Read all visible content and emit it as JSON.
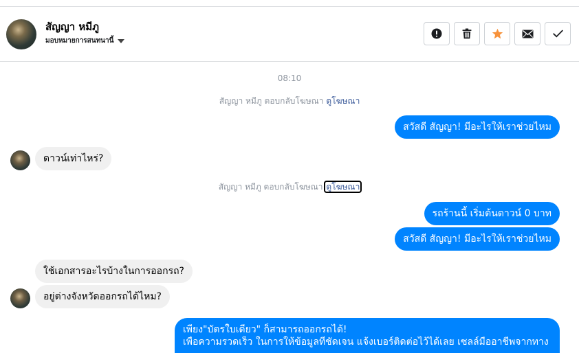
{
  "contact": {
    "name": "สัญญา หมีภู",
    "assign_label": "มอบหมายการสนทนานี้"
  },
  "actions": [
    {
      "name": "report-button",
      "icon": "exclamation-circle-icon"
    },
    {
      "name": "delete-button",
      "icon": "trash-icon"
    },
    {
      "name": "star-button",
      "icon": "star-icon"
    },
    {
      "name": "mark-unread-button",
      "icon": "envelope-icon"
    },
    {
      "name": "mark-done-button",
      "icon": "checkmark-icon"
    }
  ],
  "thread": {
    "time": "08:10",
    "notice_text": "สัญญา หมีภู ตอบกลับโฆษณา",
    "notice_link": "ดูโฆษณา",
    "messages": [
      "สวัสดี สัญญา! มีอะไรให้เราช่วยไหม",
      "ดาวน์เท่าไหร่?",
      "รถร้านนี้ เริ่มต้นดาวน์ 0 บาท",
      "สวัสดี สัญญา! มีอะไรให้เราช่วยไหม",
      "ใช้เอกสารอะไรบ้างในการออกรถ?",
      "อยู่ต่างจังหวัดออกรถได้ไหม?",
      "เพียง\"บัตรใบเดียว\" ก็สามารถออกรถได้!",
      "เพื่อความรวดเร็ว ในการให้ข้อมูลที่ชัดเจน แจ้งเบอร์ติดต่อไว้ได้เลย เซลล์มืออาชีพจากทาง"
    ]
  },
  "colors": {
    "outgoing": "#0084ff",
    "incoming": "#f0f0f0",
    "star": "#f7923b",
    "link": "#385898"
  }
}
